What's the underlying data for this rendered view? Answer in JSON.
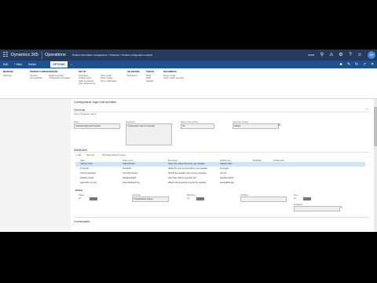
{
  "topnav": {
    "app_name": "Dynamics 365",
    "module": "Operations",
    "breadcrumbs": "Product information management  >  Products  >  Product configuration models",
    "company": "USMF",
    "avatar_initials": "AD",
    "icons": [
      "search-icon",
      "bell-icon",
      "gear-icon",
      "help-icon",
      "smile-icon"
    ]
  },
  "actionbar": {
    "edit": "Edit",
    "new": "+ New",
    "delete": "Delete",
    "options": "OPTIONS",
    "search": "⌕"
  },
  "ribbon": {
    "groups": [
      {
        "title": "Maintain",
        "items": [
          "Duplicate"
        ]
      },
      {
        "title": "Product configuration",
        "items": [
          "Versions",
          "Test validation",
          "Model properties",
          "Configuration templates"
        ]
      },
      {
        "title": "Set up",
        "items": [
          "Translation",
          "Attribute types",
          "Table constraints",
          "User requirements"
        ]
      },
      {
        "title": "",
        "items": [
          "Price model",
          "Price models",
          "Price model dates"
        ]
      },
      {
        "title": "Validation",
        "items": [
          "Derivations"
        ]
      },
      {
        "title": "Tables",
        "items": [
          "Table",
          "Table",
          "Validate"
        ]
      },
      {
        "title": "Documents",
        "items": [
          "Export model",
          "Import model to model"
        ]
      }
    ]
  },
  "page": {
    "title": "Configurable high end speaker"
  },
  "general": {
    "heading": "General",
    "subheading": "Insert or Reduced in layout",
    "fields": [
      {
        "label": "Name",
        "value": "Industrial High End Speaker"
      },
      {
        "label": "Description",
        "value": "Configurable high end speaker"
      },
      {
        "label": "Status of the product",
        "value": "No"
      },
      {
        "label": "Use solver strategy",
        "value": "Default"
      }
    ]
  },
  "attributes": {
    "heading": "Attributes",
    "toolbar": [
      "+ Add",
      "Remove",
      "Translate attribute types"
    ],
    "columns": [
      "Name",
      "Solver name",
      "Description",
      "Attribute type",
      "Modifiable",
      "Default value"
    ],
    "rows": [
      {
        "name": "Cabinet finish",
        "solver": "CabinetFinish",
        "desc": "Select the cabinet finish for your speaker",
        "type": "Cabinet finish",
        "sel": true
      },
      {
        "name": "Front grill",
        "solver": "FrontGrill",
        "desc": "Select the type of front grill for your speaker",
        "type": "Front grill",
        "sel": false
      },
      {
        "name": "Cornet protection",
        "solver": "CornetProtection",
        "desc": "Should the speaker have corner protection",
        "type": "Yes No",
        "sel": false
      },
      {
        "name": "Speaker height",
        "solver": "SpeakerHeight",
        "desc": "How high shall the speaker be?",
        "type": "SpeakerHeight",
        "sel": false
      },
      {
        "name": "Assembly run time",
        "solver": "AssemblyRunTime",
        "desc": "What is the assembly time for the speaker",
        "type": "GeneralDomain",
        "sel": false
      }
    ]
  },
  "details": {
    "heading": "Details",
    "fields": [
      {
        "label": "Hidden",
        "value": "No"
      },
      {
        "label": "Constraint",
        "value": "TracedDefault Values"
      },
      {
        "label": "Mandatory",
        "value": "No"
      },
      {
        "label": "Condition",
        "value": ""
      },
      {
        "label": "Keys",
        "value": "No"
      },
      {
        "label": "Conditions",
        "value": ""
      }
    ]
  },
  "constraints": {
    "heading": "Constraints"
  }
}
